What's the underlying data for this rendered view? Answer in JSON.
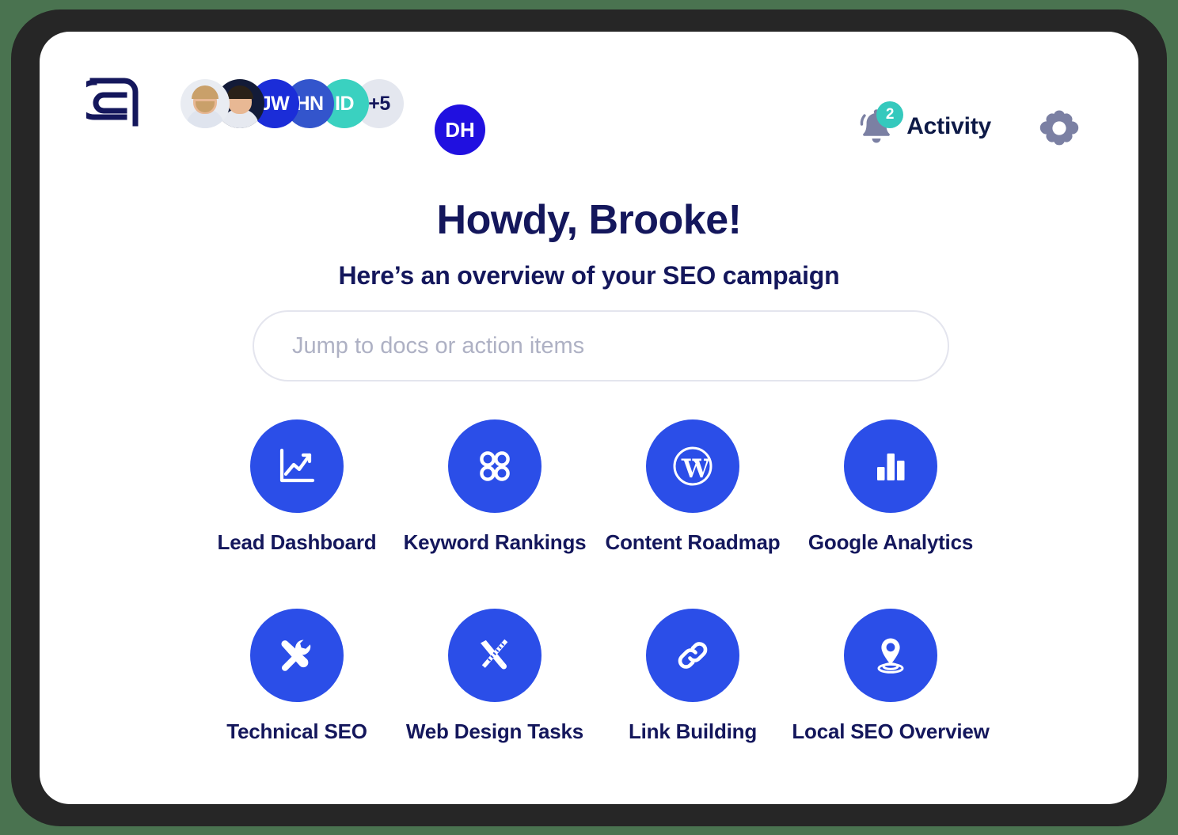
{
  "theme": {
    "page_background": "#4a7350",
    "device_bezel": "#262626",
    "screen_background": "#ffffff",
    "accent_blue": "#2b4ee8",
    "text_navy": "#14175c",
    "badge_teal": "#35c9bd",
    "icon_gray": "#7b80a3",
    "placeholder_gray": "#aeb1c4",
    "input_border": "#e4e5ee"
  },
  "header": {
    "logo_name": "stylized-a-monogram",
    "avatars": [
      {
        "type": "photo",
        "name": "member-photo-1",
        "initials": "",
        "background": "#e9ecf2",
        "skin": "#e8b894",
        "hair": "#c9a06a",
        "shirt": "#dfe4ee"
      },
      {
        "type": "photo",
        "name": "member-photo-2",
        "initials": "",
        "background": "#131b38",
        "skin": "#e8b894",
        "hair": "#2a2118",
        "shirt": "#e6e9f0"
      },
      {
        "type": "initials",
        "name": "member-jw",
        "initials": "JW",
        "background": "#1b2dd8"
      },
      {
        "type": "initials",
        "name": "member-hn",
        "initials": "HN",
        "background": "#3355cc"
      },
      {
        "type": "initials",
        "name": "member-id",
        "initials": "ID",
        "background": "#3ad1c0"
      },
      {
        "type": "overflow",
        "name": "member-overflow",
        "initials": "+5",
        "background": "#e4e7ef",
        "text_color": "#14175c"
      }
    ],
    "current_user": {
      "initials": "DH",
      "background": "#2010e0"
    },
    "notification_count": "2",
    "activity_label": "Activity",
    "bell_icon": "bell-icon",
    "settings_icon": "gear-icon"
  },
  "greeting": {
    "title": "Howdy, Brooke!",
    "subtitle": "Here’s an overview of your SEO campaign"
  },
  "search": {
    "placeholder": "Jump to docs or action items",
    "value": ""
  },
  "shortcuts": [
    {
      "label": "Lead Dashboard",
      "icon": "line-chart-icon"
    },
    {
      "label": "Keyword Rankings",
      "icon": "four-circles-grid-icon"
    },
    {
      "label": "Content Roadmap",
      "icon": "wordpress-icon"
    },
    {
      "label": "Google Analytics",
      "icon": "bar-chart-icon"
    },
    {
      "label": "Technical SEO",
      "icon": "tools-icon"
    },
    {
      "label": "Web Design Tasks",
      "icon": "pencil-ruler-icon"
    },
    {
      "label": "Link Building",
      "icon": "chain-link-icon"
    },
    {
      "label": "Local SEO Overview",
      "icon": "map-pin-icon"
    }
  ]
}
